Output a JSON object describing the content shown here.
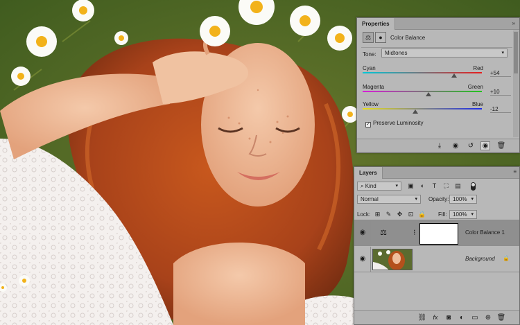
{
  "canvas": {
    "description_icon": "photo-canvas"
  },
  "properties": {
    "tab_label": "Properties",
    "title": "Color Balance",
    "tone_label": "Tone:",
    "tone_value": "Midtones",
    "sliders": [
      {
        "left": "Cyan",
        "right": "Red",
        "value": "+54",
        "level": 0.77
      },
      {
        "left": "Magenta",
        "right": "Green",
        "value": "+10",
        "level": 0.55
      },
      {
        "left": "Yellow",
        "right": "Blue",
        "value": "-12",
        "level": 0.44
      }
    ],
    "preserve_luminosity": "Preserve Luminosity",
    "preserve_checked": true,
    "footer_icons": [
      "clip-to-layer-icon",
      "view-previous-icon",
      "reset-icon",
      "visibility-icon",
      "delete-icon"
    ]
  },
  "layers": {
    "tab_label": "Layers",
    "filter_kind": "Kind",
    "blend_mode": "Normal",
    "opacity_label": "Opacity:",
    "opacity_value": "100%",
    "lock_label": "Lock:",
    "fill_label": "Fill:",
    "fill_value": "100%",
    "items": [
      {
        "name": "Color Balance 1",
        "selected": true,
        "type": "adjustment"
      },
      {
        "name": "Background",
        "selected": false,
        "type": "image",
        "locked": true
      }
    ],
    "footer_icons": [
      "link-icon",
      "fx-icon",
      "mask-icon",
      "adjustment-icon",
      "group-icon",
      "new-layer-icon",
      "delete-icon"
    ]
  },
  "colors": {
    "panel": "#b8b8b8",
    "selected_row": "#8f8f8f"
  }
}
